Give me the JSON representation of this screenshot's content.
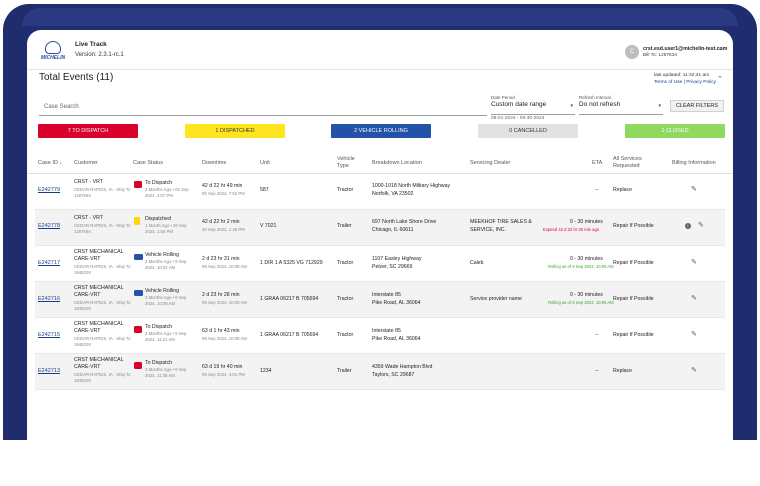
{
  "header": {
    "logo_text": "MICHELIN",
    "app_name": "Live Track",
    "version": "Version: 2.3.1-rc.1",
    "user_initial": "C",
    "user_email": "crst.esd.user1@michelin-test.com",
    "bill_to": "Bill To: 1287634"
  },
  "page": {
    "title": "Total Events (11)",
    "last_updated": "last updated: 11:42:41 am",
    "terms": "Terms of Use",
    "separator": "|",
    "privacy": "Privacy Policy"
  },
  "filters": {
    "search_placeholder": "Case Search",
    "date_period_label": "Date Period",
    "date_period_value": "Custom date range",
    "date_range": "08-01-2024 - 09-30-2024",
    "refresh_label": "Refresh Interval",
    "refresh_value": "Do not refresh",
    "clear_label": "CLEAR FILTERS"
  },
  "status_chips": {
    "to_dispatch": "7 TO DISPATCH",
    "dispatched": "1 DISPATCHED",
    "rolling": "2 VEHICLE ROLLING",
    "cancelled": "0 CANCELLED",
    "closed": "1 CLOSED"
  },
  "colors": {
    "to_dispatch": "#d9002c",
    "dispatched": "#ffe51f",
    "rolling": "#2452a8",
    "cancelled": "#e2e2e2",
    "closed": "#8fd95f",
    "frame": "#1f2d6e"
  },
  "columns": {
    "case_id": "Case ID ↓",
    "customer": "Customer",
    "case_status": "Case Status",
    "downtime": "Downtime",
    "unit": "Unit",
    "vehicle_type_1": "Vehicle",
    "vehicle_type_2": "Type",
    "breakdown": "Breakdown Location",
    "dealer": "Servicing Dealer",
    "eta": "ETA",
    "services_1": "All Services",
    "services_2": "Requested",
    "billing": "Billing Information"
  },
  "rows": [
    {
      "case_id": "E242779",
      "customer": "CRST - VRT",
      "customer_sub1": "CEDAR RAPIDS, IA - Ship To",
      "customer_sub2": "1287694",
      "status": "To Dispatch",
      "status_icon": "tow-truck-icon",
      "status_sub1": "2 Months Ago • 05 Sep",
      "status_sub2": "2024, 4:07 PM",
      "downtime": "42 d 22 hr 49 min",
      "downtime_sub": "05 Sep 2024, 7:52 PM",
      "unit": "587",
      "vehicle_type": "Tractor",
      "location1": "1000-1018 North Military Highway",
      "location2": "Norfolk, VA 23502",
      "dealer1": "",
      "dealer2": "",
      "eta": "--",
      "eta_sub": "",
      "services": "Replace"
    },
    {
      "case_id": "E242778",
      "customer": "CRST - VRT",
      "customer_sub1": "CEDAR RAPIDS, IA - Ship To",
      "customer_sub2": "1287694",
      "status": "Dispatched",
      "status_icon": "dispatched-icon",
      "status_sub1": "1 Month Ago • 26 Sep",
      "status_sub2": "2024, 1:56 PM",
      "downtime": "42 d 22 hr 2 min",
      "downtime_sub": "26 Sep 2024, 1:29 PM",
      "unit": "V 7021",
      "vehicle_type": "Trailer",
      "location1": "697 North Lake Shore Drive",
      "location2": "Chicago, IL 60611",
      "dealer1": "MEEKHOF TIRE SALES &",
      "dealer2": "SERVICE, INC.",
      "eta": "0 - 30 minutes",
      "eta_sub": "Expired 42 d 22 hr 30 min ago",
      "services": "Repair If Possible"
    },
    {
      "case_id": "E242717",
      "customer": "CRST MECHANICAL",
      "customer_sub1": "CARE-VRT",
      "customer_sub2": "CEDAR RAPIDS, IA - Ship To",
      "customer_sub3": "1948228",
      "status": "Vehicle Rolling",
      "status_icon": "truck-icon",
      "status_sub1": "2 Months Ago • 9 Sep",
      "status_sub2": "2024, 10:02 AM",
      "downtime": "2 d 23 hr 31 min",
      "downtime_sub": "09 Sep 2024, 10:09 AM",
      "unit": "1 DIR 1 A 5325 VG 712929",
      "vehicle_type": "Tractor",
      "location1": "1107 Easley Highway",
      "location2": "Pelzer, SC 29669",
      "dealer1": "Caleb",
      "dealer2": "",
      "eta": "0 - 30 minutes",
      "eta_sub": "Rolling as of 9 Sep 2024, 10:09 AM",
      "services": "Repair If Possible"
    },
    {
      "case_id": "E242716",
      "customer": "CRST MECHANICAL",
      "customer_sub1": "CARE-VRT",
      "customer_sub2": "CEDAR RAPIDS, IA - Ship To",
      "customer_sub3": "1948228",
      "status": "Vehicle Rolling",
      "status_icon": "truck-icon",
      "status_sub1": "2 Months Ago • 9 Sep",
      "status_sub2": "2024, 10:08 AM",
      "downtime": "2 d 23 hr 28 min",
      "downtime_sub": "09 Sep 2024, 10:09 AM",
      "unit": "1 GRAA 06217 B 705694",
      "vehicle_type": "Tractor",
      "location1": "Interstate 85",
      "location2": "Pike Road, AL 36064",
      "dealer1": "Service provider name",
      "dealer2": "",
      "eta": "0 - 30 minutes",
      "eta_sub": "Rolling as of 9 Sep 2024, 10:09 AM",
      "services": "Repair If Possible"
    },
    {
      "case_id": "E242715",
      "customer": "CRST MECHANICAL",
      "customer_sub1": "CARE-VRT",
      "customer_sub2": "CEDAR RAPIDS, IA - Ship To",
      "customer_sub3": "1948228",
      "status": "To Dispatch",
      "status_icon": "tow-truck-icon",
      "status_sub1": "2 Months Ago • 9 Sep",
      "status_sub2": "2024, 11:21 AM",
      "downtime": "63 d 1 hr 43 min",
      "downtime_sub": "09 Sep 2024, 10:09 AM",
      "unit": "1 GRAA 06217 B 705694",
      "vehicle_type": "Tractor",
      "location1": "Interstate 85",
      "location2": "Pike Road, AL 36064",
      "dealer1": "",
      "dealer2": "",
      "eta": "--",
      "eta_sub": "",
      "services": "Repair If Possible"
    },
    {
      "case_id": "E242713",
      "customer": "CRST MECHANICAL",
      "customer_sub1": "CARE-VRT",
      "customer_sub2": "CEDAR RAPIDS, IA - Ship To",
      "customer_sub3": "1948228",
      "status": "To Dispatch",
      "status_icon": "tow-truck-icon",
      "status_sub1": "2 Months Ago • 9 Sep",
      "status_sub2": "2024, 11:38 AM",
      "downtime": "63 d 19 hr 40 min",
      "downtime_sub": "09 Sep 2024, 4:01 PM",
      "unit": "1234",
      "vehicle_type": "Trailer",
      "location1": "4359 Wade Hampton Blvd",
      "location2": "Taylors, SC 29687",
      "dealer1": "",
      "dealer2": "",
      "eta": "--",
      "eta_sub": "",
      "services": "Replace"
    }
  ]
}
